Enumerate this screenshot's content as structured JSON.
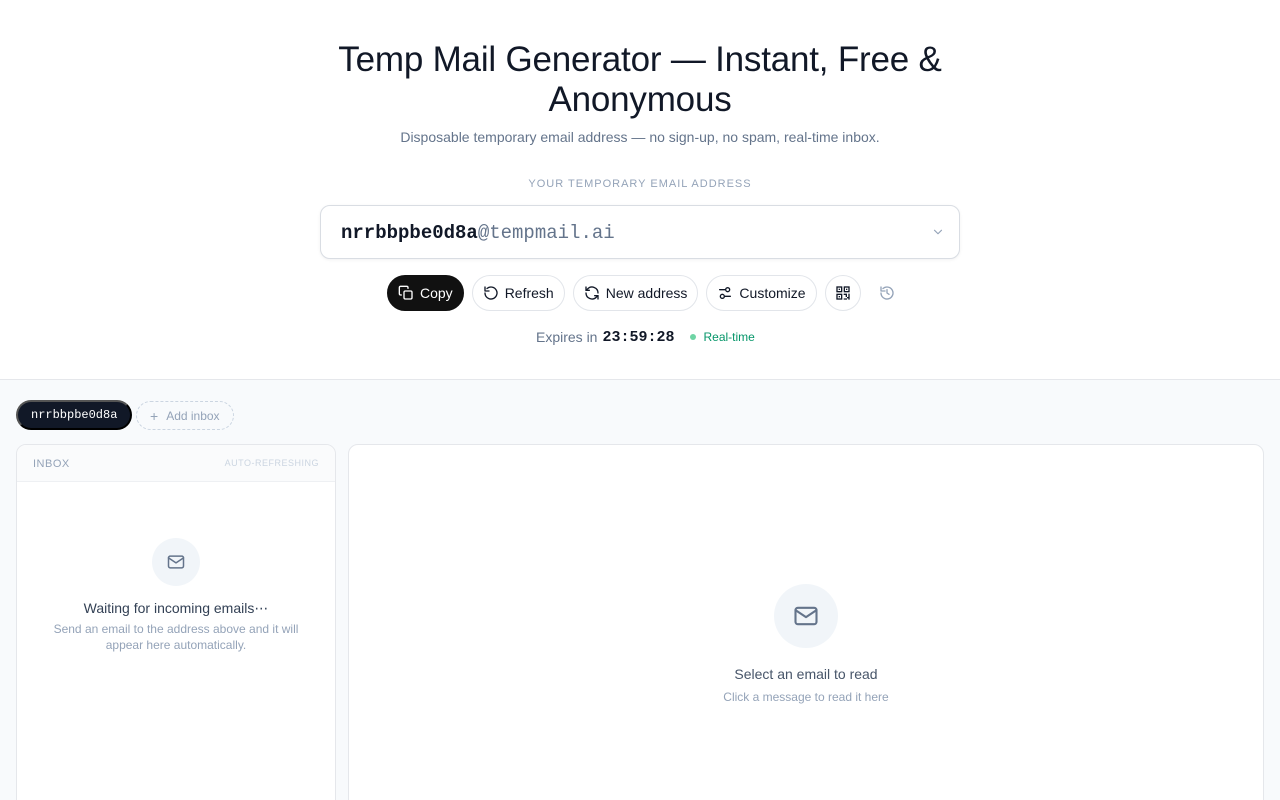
{
  "hero": {
    "title": "Temp Mail Generator — Instant, Free & Anonymous",
    "subtitle": "Disposable temporary email address — no sign-up, no spam, real-time inbox.",
    "address_label": "YOUR TEMPORARY EMAIL ADDRESS"
  },
  "address": {
    "user": "nrrbbpbe0d8a",
    "domain": "@tempmail.ai"
  },
  "actions": {
    "copy_label": "Copy",
    "refresh_label": "Refresh",
    "new_address_label": "New address",
    "customize_label": "Customize",
    "qr_icon": "qr-code-icon",
    "history_icon": "history-icon"
  },
  "status": {
    "expires_label": "Expires in",
    "timer": "23:59:28",
    "realtime_label": "Real-time"
  },
  "inboxes": {
    "active": "nrrbbpbe0d8a",
    "add_label": "Add inbox"
  },
  "inbox_panel": {
    "title": "INBOX",
    "auto_refresh": "AUTO-REFRESHING",
    "empty_title": "Waiting for incoming emails⋯",
    "empty_desc": "Send an email to the address above and it will appear here automatically."
  },
  "reader": {
    "empty_title": "Select an email to read",
    "empty_desc": "Click a message to read it here"
  },
  "colors": {
    "primary": "#111111",
    "realtime": "#059669",
    "realtime_dot": "#6ed4a4",
    "muted": "#94a3b8",
    "lower_bg": "#f8fafc"
  }
}
